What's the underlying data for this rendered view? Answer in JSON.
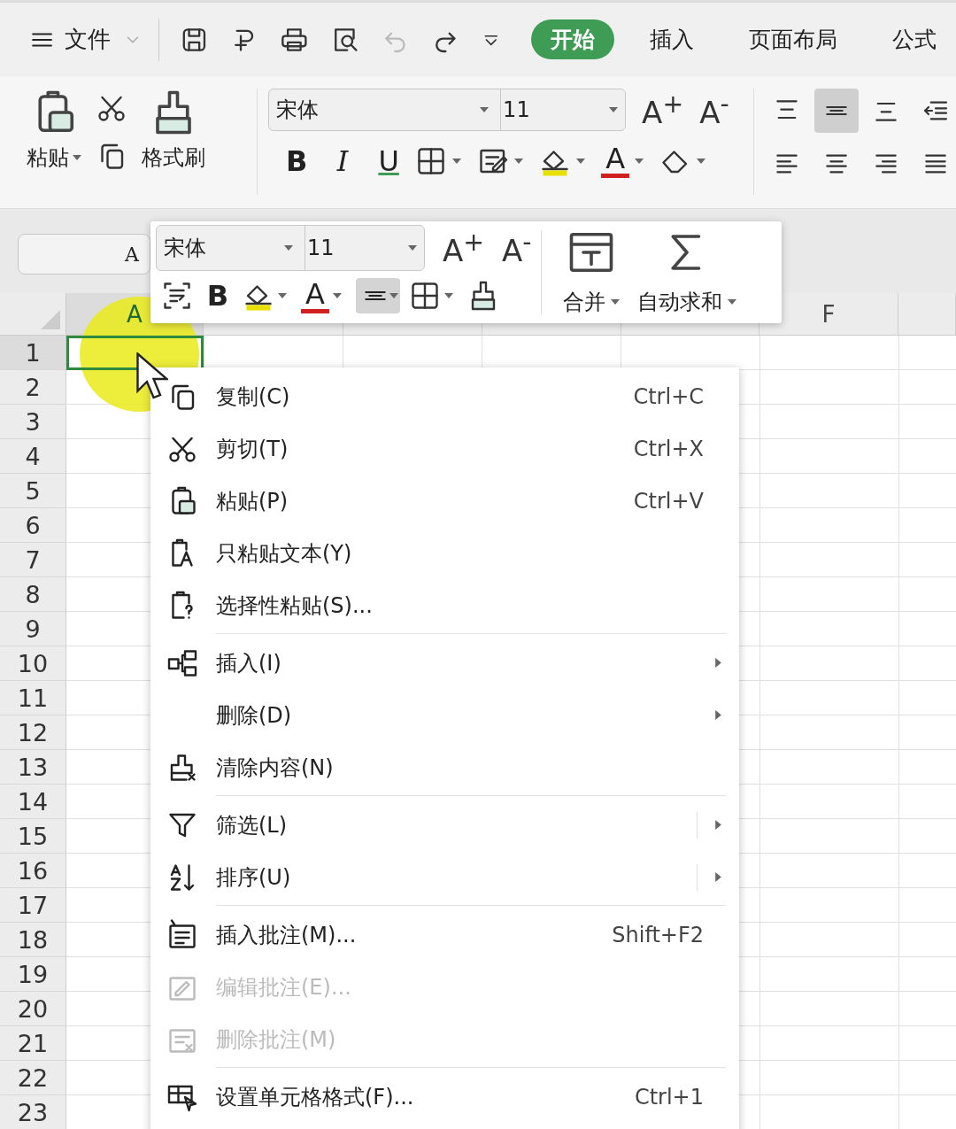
{
  "menu": {
    "label": "文件"
  },
  "tabs": [
    {
      "label": "开始",
      "selected": true
    },
    {
      "label": "插入",
      "selected": false
    },
    {
      "label": "页面布局",
      "selected": false
    },
    {
      "label": "公式",
      "selected": false
    }
  ],
  "ribbon": {
    "paste": "粘贴",
    "format_painter": "格式刷",
    "font": "宋体",
    "size": "11",
    "grow": "A$^{+}$",
    "shrink": "A$^{-}$",
    "bold": "B",
    "italic": "I",
    "underline": "U",
    "font_color": "A",
    "align": [
      {
        "selected": false
      },
      {
        "selected": true
      },
      {
        "selected": false
      },
      {
        "selected": false
      },
      {
        "selected": false
      },
      {
        "selected": false
      },
      {
        "selected": false
      },
      {
        "selected": false
      }
    ]
  },
  "name_box": "A",
  "mini_toolbar": {
    "font": "宋体",
    "size": "11",
    "grow": "A$^{+}$",
    "shrink": "A$^{-}$",
    "bold": "B",
    "font_color": "A",
    "align_selected": true,
    "merge": "合并",
    "autosum": "自动求和"
  },
  "columns": [
    {
      "label": "A"
    },
    {},
    {},
    {},
    {},
    {
      "label": "F"
    },
    {}
  ],
  "rows": [
    "1",
    "2",
    "3",
    "4",
    "5",
    "6",
    "7",
    "8",
    "9",
    "10",
    "11",
    "12",
    "13",
    "14",
    "15",
    "16",
    "17",
    "18",
    "19",
    "20",
    "21",
    "22",
    "23"
  ],
  "context_menu": [
    {
      "kind": "item",
      "label": "复制(C)",
      "shortcut": "Ctrl+C",
      "disabled": false,
      "submenu": false
    },
    {
      "kind": "item",
      "label": "剪切(T)",
      "shortcut": "Ctrl+X",
      "disabled": false,
      "submenu": false
    },
    {
      "kind": "item",
      "label": "粘贴(P)",
      "shortcut": "Ctrl+V",
      "disabled": false,
      "submenu": false
    },
    {
      "kind": "item",
      "label": "只粘贴文本(Y)",
      "disabled": false,
      "submenu": false
    },
    {
      "kind": "item",
      "label": "选择性粘贴(S)...",
      "disabled": false,
      "submenu": false
    },
    {
      "kind": "separator"
    },
    {
      "kind": "item",
      "label": "插入(I)",
      "disabled": false,
      "submenu": true
    },
    {
      "kind": "item",
      "label": "删除(D)",
      "disabled": false,
      "submenu": true
    },
    {
      "kind": "item",
      "label": "清除内容(N)",
      "disabled": false,
      "submenu": false
    },
    {
      "kind": "separator"
    },
    {
      "kind": "item",
      "label": "筛选(L)",
      "disabled": false,
      "submenu": true
    },
    {
      "kind": "item",
      "label": "排序(U)",
      "disabled": false,
      "submenu": true
    },
    {
      "kind": "separator"
    },
    {
      "kind": "item",
      "label": "插入批注(M)...",
      "shortcut": "Shift+F2",
      "disabled": false,
      "submenu": false
    },
    {
      "kind": "item",
      "label": "编辑批注(E)...",
      "disabled": true,
      "submenu": false
    },
    {
      "kind": "item",
      "label": "删除批注(M)",
      "disabled": true,
      "submenu": false
    },
    {
      "kind": "separator"
    },
    {
      "kind": "item",
      "label": "设置单元格格式(F)...",
      "shortcut": "Ctrl+1",
      "disabled": false,
      "submenu": false
    }
  ]
}
